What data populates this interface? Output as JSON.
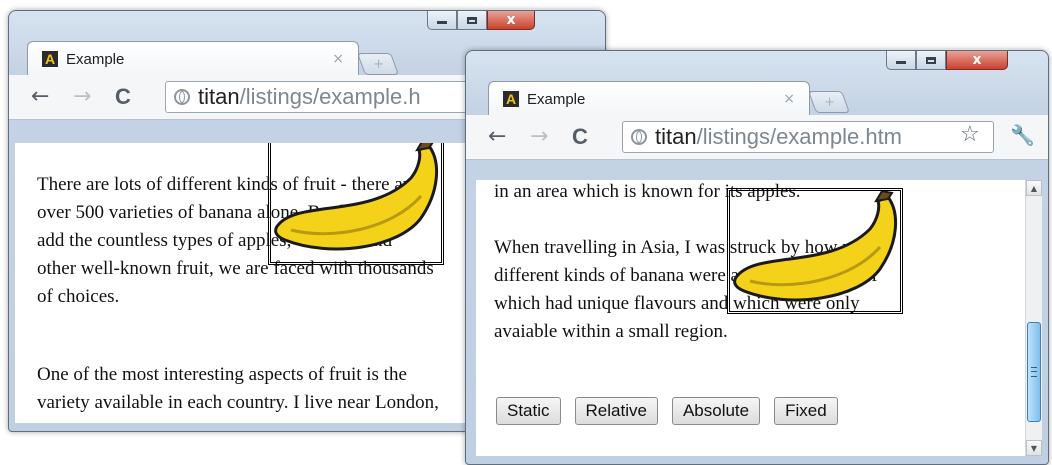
{
  "windows": [
    {
      "tab_title": "Example",
      "url_host": "titan",
      "url_path": "/listings/example.h",
      "paragraphs": [
        [
          "There are lots of different kinds of fruit - there are",
          "over 500 varieties of banana alone. By the time we",
          "add the countless types of apples, oranges, and",
          "other well-known fruit, we are faced with thousands",
          "of choices."
        ],
        [
          "One of the most interesting aspects of fruit is the",
          "variety available in each country. I live near London,"
        ]
      ]
    },
    {
      "tab_title": "Example",
      "url_host": "titan",
      "url_path": "/listings/example.htm",
      "paragraphs": [
        [
          "in an area which is known for its apples."
        ],
        [
          "When travelling in Asia, I was struck by how many",
          "different kinds of banana were available - many of",
          "which had unique flavours and which were only",
          "avaiable within a small region."
        ]
      ],
      "buttons": [
        "Static",
        "Relative",
        "Absolute",
        "Fixed"
      ]
    }
  ],
  "icons": {
    "favicon_letter": "A",
    "back": "←",
    "forward": "→",
    "reload": "C",
    "tab_close": "×",
    "new_tab": "+",
    "star": "☆",
    "wrench": "🔧",
    "close_window": "x"
  },
  "colors": {
    "banana_fill": "#f4d21a",
    "banana_outline": "#1a1a1a",
    "scroll_thumb": "#7cc0ee"
  }
}
